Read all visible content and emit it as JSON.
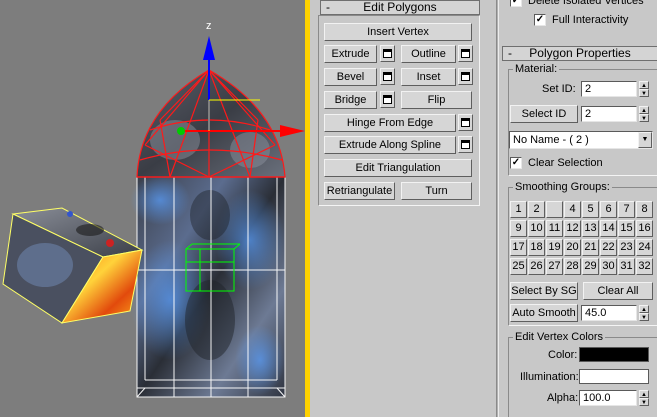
{
  "viewport": {
    "gizmo_axis_label": "z",
    "gizmo_colors": {
      "z": "#0000ff",
      "x": "#ff0000",
      "y": "#00ff00"
    },
    "background_color": "#7d7d7d",
    "active_border_color": "#ffd200"
  },
  "edit_polygons": {
    "title": "Edit Polygons",
    "buttons": {
      "insert_vertex": "Insert Vertex",
      "extrude": "Extrude",
      "outline": "Outline",
      "bevel": "Bevel",
      "inset": "Inset",
      "bridge": "Bridge",
      "flip": "Flip",
      "hinge_from_edge": "Hinge From Edge",
      "extrude_along_spline": "Extrude Along Spline",
      "edit_triangulation": "Edit Triangulation",
      "retriangulate": "Retriangulate",
      "turn": "Turn"
    }
  },
  "top_options": {
    "delete_isolated_vertices": "Delete Isolated Vertices",
    "delete_isolated_checked": true,
    "full_interactivity": "Full Interactivity",
    "full_interactivity_checked": true
  },
  "polygon_properties": {
    "title": "Polygon Properties",
    "material": {
      "group_label": "Material:",
      "set_id_label": "Set ID:",
      "set_id_value": "2",
      "select_id_button": "Select ID",
      "select_id_value": "2",
      "name_dropdown_value": "No Name - ( 2 )",
      "clear_selection_label": "Clear Selection",
      "clear_selection_checked": true
    },
    "smoothing_groups": {
      "group_label": "Smoothing Groups:",
      "numbers": [
        "1",
        "2",
        "",
        "4",
        "5",
        "6",
        "7",
        "8",
        "9",
        "10",
        "11",
        "12",
        "13",
        "14",
        "15",
        "16",
        "17",
        "18",
        "19",
        "20",
        "21",
        "22",
        "23",
        "24",
        "25",
        "26",
        "27",
        "28",
        "29",
        "30",
        "31",
        "32"
      ],
      "select_by_sg": "Select By SG",
      "clear_all": "Clear All",
      "auto_smooth": "Auto Smooth",
      "auto_smooth_value": "45.0"
    },
    "vertex_colors": {
      "group_label": "Edit Vertex Colors",
      "color_label": "Color:",
      "color_value": "#000000",
      "illumination_label": "Illumination:",
      "illumination_value": "#ffffff",
      "alpha_label": "Alpha:",
      "alpha_value": "100.0"
    }
  }
}
